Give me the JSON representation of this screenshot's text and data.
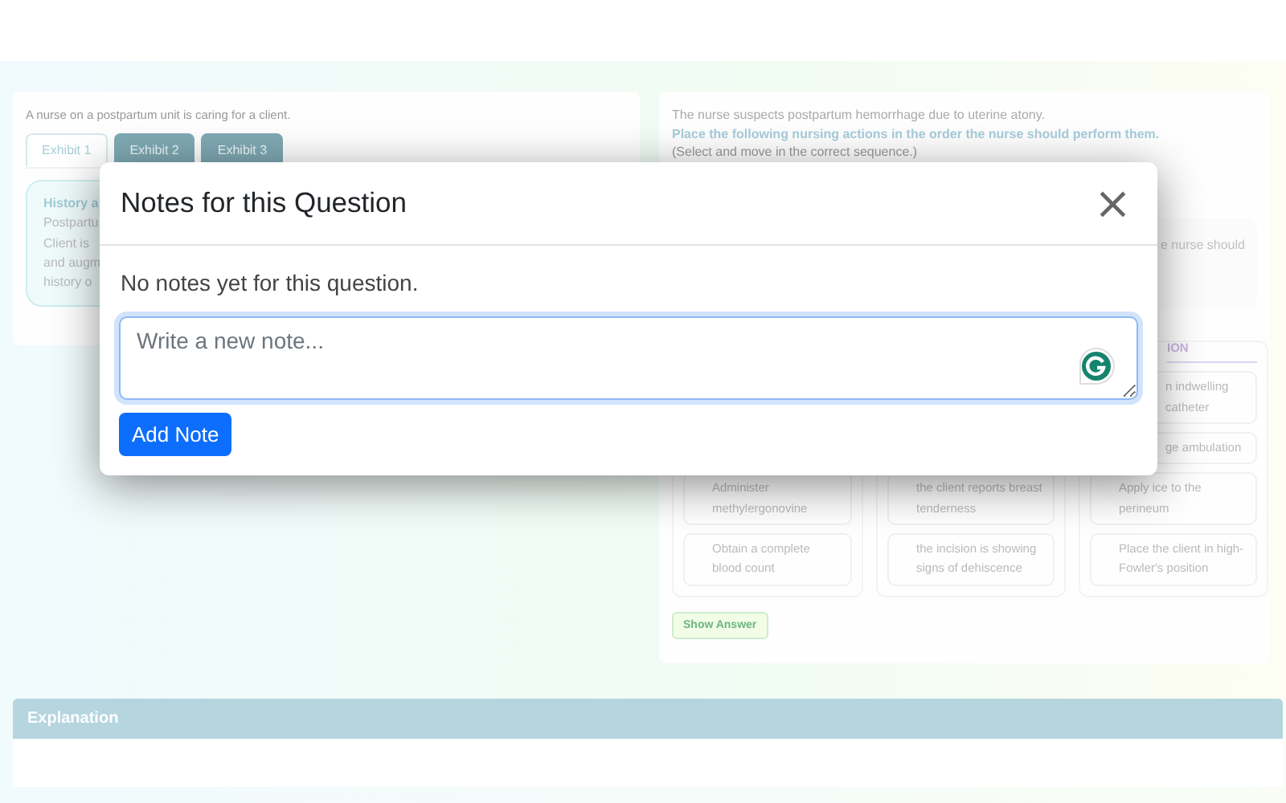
{
  "case": {
    "intro": "A nurse on a postpartum unit is caring for a client.",
    "tabs": [
      {
        "label": "Exhibit 1",
        "selected": true
      },
      {
        "label": "Exhibit 2",
        "selected": false
      },
      {
        "label": "Exhibit 3",
        "selected": false
      }
    ],
    "exhibit_lines": [
      "History a",
      "Postpartu",
      "Client is",
      "and augm",
      "history o"
    ]
  },
  "question": {
    "scenario": "The nurse suspects postpartum hemorrhage due to uterine atony.",
    "instruction": "Place the following nursing actions in the order the nurse should perform them.",
    "hint": "(Select and move in the correct sequence.)",
    "prompt_fragment": "e nurse should",
    "columns": [
      {
        "items": [
          {
            "text": "Administer methylergonovine",
            "kind": "full"
          },
          {
            "text": "Obtain a complete blood count",
            "kind": "full"
          }
        ]
      },
      {
        "items": [
          {
            "text": "the client reports breast tenderness",
            "kind": "full"
          },
          {
            "text": "the incision is showing signs of dehiscence",
            "kind": "full"
          }
        ]
      },
      {
        "header": "ION",
        "items": [
          {
            "text": "n indwelling catheter",
            "kind": "cut"
          },
          {
            "text": "ge ambulation",
            "kind": "cut"
          },
          {
            "text": "Apply ice to the perineum",
            "kind": "full"
          },
          {
            "text": "Place the client in high-Fowler's position",
            "kind": "full"
          }
        ]
      }
    ],
    "show_answer": "Show Answer"
  },
  "explanation": {
    "title": "Explanation"
  },
  "modal": {
    "title": "Notes for this Question",
    "close": "×",
    "empty_message": "No notes yet for this question.",
    "note_field": {
      "placeholder": "Write a new note..."
    },
    "add_button": "Add Note"
  }
}
